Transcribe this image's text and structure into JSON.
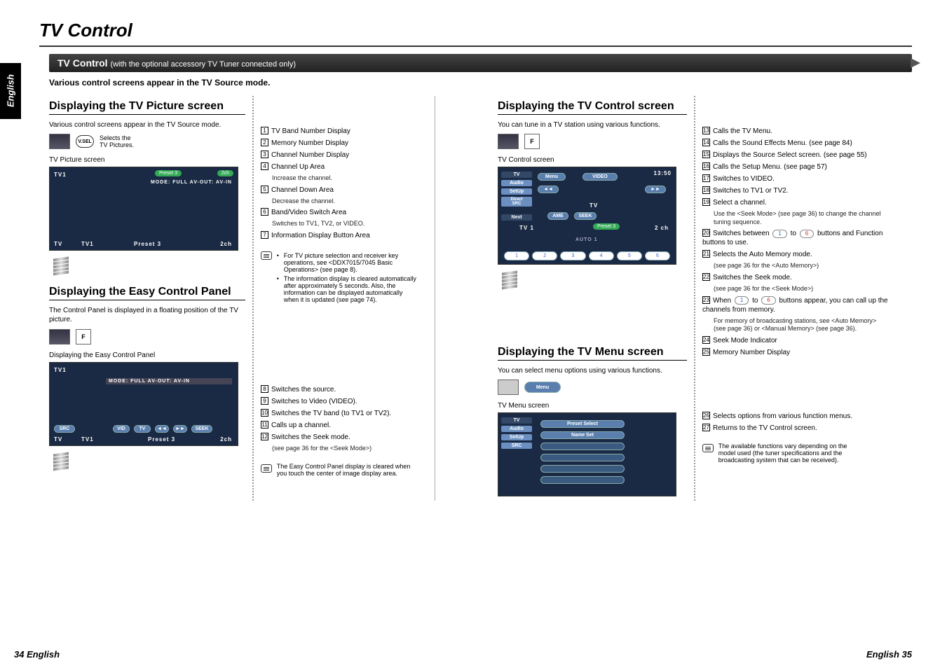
{
  "lang_tab": "English",
  "main_title": "TV Control",
  "header_main": "TV Control",
  "header_sub": "(with the optional accessory TV Tuner connected only)",
  "intro": "Various control screens appear in the TV Source mode.",
  "sec1_title": "Displaying the TV Picture screen",
  "sec1_para": "Various control screens appear in the TV Source mode.",
  "sec1_hand_label": "V.SEL",
  "sec1_hand_desc": "Selects the\nTV Pictures.",
  "sec1_screen_label": "TV Picture screen",
  "ss1": {
    "tv1": "TV1",
    "preset": "Preset 3",
    "twoch": "2ch",
    "mode": "MODE: FULL   AV-OUT: AV-IN",
    "foot_tv": "TV",
    "foot_tv1": "TV1",
    "foot_preset": "Preset 3",
    "foot_2ch": "2ch"
  },
  "leg1": [
    {
      "n": "1",
      "t": "TV Band Number Display"
    },
    {
      "n": "2",
      "t": "Memory Number Display"
    },
    {
      "n": "3",
      "t": "Channel Number Display"
    },
    {
      "n": "4",
      "t": "Channel Up Area",
      "s": "Increase the channel."
    },
    {
      "n": "5",
      "t": "Channel Down Area",
      "s": "Decrease the channel."
    },
    {
      "n": "6",
      "t": "Band/Video Switch Area",
      "s": "Switches to TV1, TV2, or VIDEO."
    },
    {
      "n": "7",
      "t": "Information Display Button Area"
    }
  ],
  "note1a": "For TV picture selection and receiver key operations, see <DDX7015/7045 Basic Operations> (see page 8).",
  "note1b": "The information display is cleared automatically after approximately 5 seconds. Also, the information can be displayed automatically when it is updated (see page 74).",
  "sec2_title": "Displaying the Easy Control Panel",
  "sec2_para": "The Control Panel is displayed in a floating position of the TV picture.",
  "sec2_screen_label": "Displaying the Easy Control Panel",
  "ss2": {
    "tv1": "TV1",
    "mode": "MODE: FULL   AV-OUT: AV-IN",
    "src": "SRC",
    "vid": "VID",
    "tv": "TV",
    "foot_tv": "TV",
    "foot_tv1": "TV1",
    "foot_preset": "Preset 3",
    "foot_2ch": "2ch",
    "seek": "SEEK"
  },
  "leg2": [
    {
      "n": "8",
      "t": "Switches the source."
    },
    {
      "n": "9",
      "t": "Switches to Video (VIDEO)."
    },
    {
      "n": "10",
      "t": "Switches the TV band (to TV1 or TV2)."
    },
    {
      "n": "11",
      "t": "Calls up a channel."
    },
    {
      "n": "12",
      "t": "Switches the Seek mode.",
      "s": "(see page 36 for the <Seek Mode>)"
    }
  ],
  "note2": "The Easy Control Panel display is cleared when you touch the center of image display area.",
  "sec3_title": "Displaying the TV Control screen",
  "sec3_para": "You can tune in a TV station using various functions.",
  "sec3_screen_label": "TV Control screen",
  "ss3": {
    "tv": "TV",
    "menu": "Menu",
    "video": "VIDEO",
    "time": "13:50",
    "audio": "Audio",
    "setup": "SetUp",
    "direct": "Direct\nSRC",
    "next": "Next",
    "ame": "AME",
    "seek": "SEEK",
    "tvlbl": "TV",
    "tv1": "TV 1",
    "preset": "Preset 3",
    "twoch": "2 ch",
    "auto": "AUTO 1",
    "pbtns": [
      "1",
      "2",
      "3",
      "4",
      "5",
      "6"
    ]
  },
  "leg3": [
    {
      "n": "13",
      "t": "Calls the TV Menu."
    },
    {
      "n": "14",
      "t": "Calls the Sound Effects Menu. (see page 84)"
    },
    {
      "n": "15",
      "t": "Displays the Source Select screen. (see page 55)"
    },
    {
      "n": "16",
      "t": "Calls the Setup Menu. (see page 57)"
    },
    {
      "n": "17",
      "t": "Switches to VIDEO."
    },
    {
      "n": "18",
      "t": "Switches to TV1 or TV2."
    },
    {
      "n": "19",
      "t": "Select a channel.",
      "s": "Use the <Seek Mode> (see page 36) to change the channel tuning sequence."
    },
    {
      "n": "20",
      "t": "Switches between",
      "btn1": "1",
      "btn2": "6",
      "after": "buttons and Function buttons to use."
    },
    {
      "n": "21",
      "t": "Selects the Auto Memory mode.",
      "s": "(see page 36 for the <Auto Memory>)"
    },
    {
      "n": "22",
      "t": "Switches the Seek mode.",
      "s": "(see page 36 for the <Seek Mode>)"
    },
    {
      "n": "23",
      "t": "When",
      "btn1": "1",
      "btn2": "6",
      "after": "buttons appear, you can call up the channels from memory.",
      "s": "For memory of broadcasting stations, see <Auto Memory> (see page 36) or <Manual Memory> (see page 36)."
    },
    {
      "n": "24",
      "t": "Seek Mode Indicator"
    },
    {
      "n": "25",
      "t": "Memory Number Display"
    }
  ],
  "sec4_title": "Displaying the TV Menu screen",
  "sec4_para": "You can select menu options using various functions.",
  "sec4_menu_btn": "Menu",
  "sec4_screen_label": "TV Menu screen",
  "ss4": {
    "tv": "TV",
    "audio": "Audio",
    "setup": "SetUp",
    "src": "SRC",
    "preset": "Preset Select",
    "name": "Name Set"
  },
  "leg4": [
    {
      "n": "26",
      "t": "Selects options from various function menus."
    },
    {
      "n": "27",
      "t": "Returns to the TV Control screen."
    }
  ],
  "note4": "The available functions vary depending on the model used (the tuner specifications and the broadcasting system that can be received).",
  "footer_left": "34 English",
  "footer_right": "English 35"
}
